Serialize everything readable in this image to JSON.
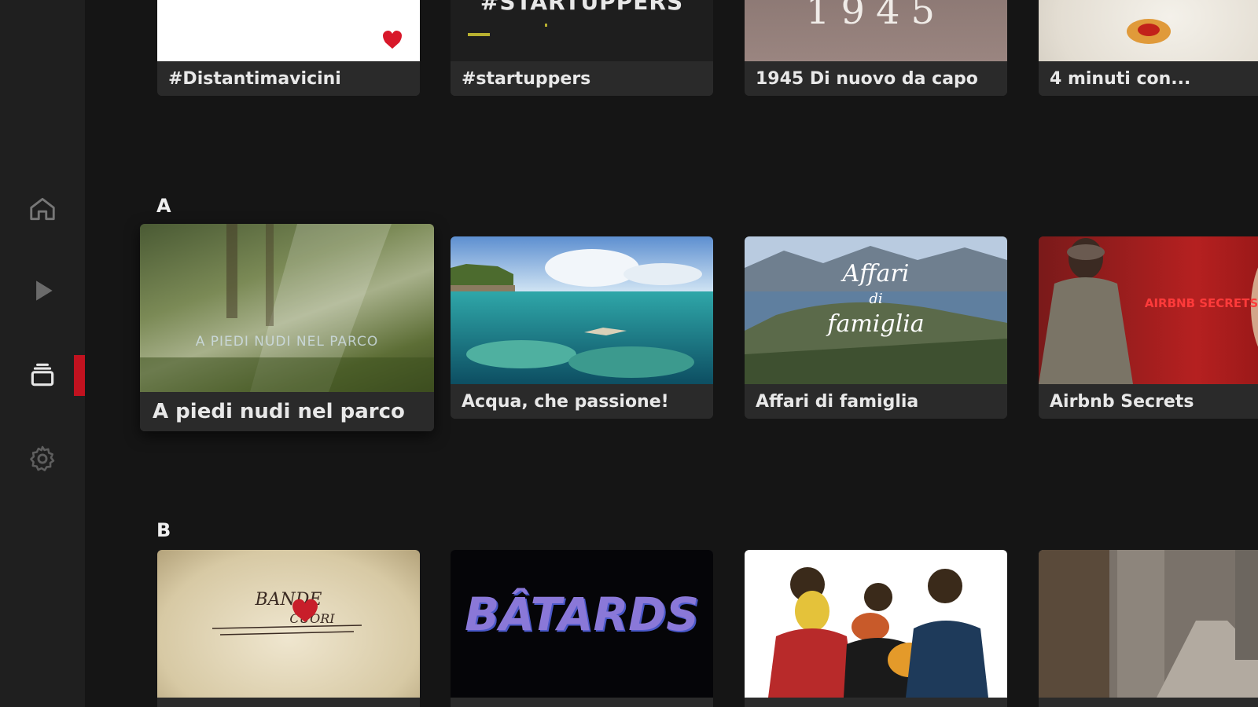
{
  "sidebar": {
    "items": [
      {
        "name": "home",
        "icon": "home-icon"
      },
      {
        "name": "play",
        "icon": "play-icon"
      },
      {
        "name": "catalog",
        "icon": "catalog-icon",
        "active": true
      },
      {
        "name": "settings",
        "icon": "gear-icon"
      }
    ],
    "accent_color": "#c1121f"
  },
  "sections": {
    "top": {
      "items": [
        {
          "title": "#Distantimavicini"
        },
        {
          "title": "#startuppers",
          "thumb_text": "#STARTUPPERS"
        },
        {
          "title": "1945 Di nuovo da capo",
          "thumb_text": "1945"
        },
        {
          "title": "4 minuti con..."
        }
      ]
    },
    "a": {
      "letter": "A",
      "items": [
        {
          "title": "A piedi nudi nel parco",
          "thumb_text": "A PIEDI NUDI NEL PARCO"
        },
        {
          "title": "Acqua, che passione!"
        },
        {
          "title": "Affari di famiglia",
          "thumb_text_1": "Affari",
          "thumb_text_2": "di",
          "thumb_text_3": "famiglia"
        },
        {
          "title": "Airbnb Secrets",
          "thumb_text": "AIRBNB SECRETS"
        }
      ]
    },
    "b": {
      "letter": "B",
      "items": [
        {
          "thumb_text_1": "BANDE",
          "thumb_text_2": "CUORI"
        },
        {
          "thumb_text": "BÂTARDS"
        },
        {},
        {}
      ]
    }
  }
}
